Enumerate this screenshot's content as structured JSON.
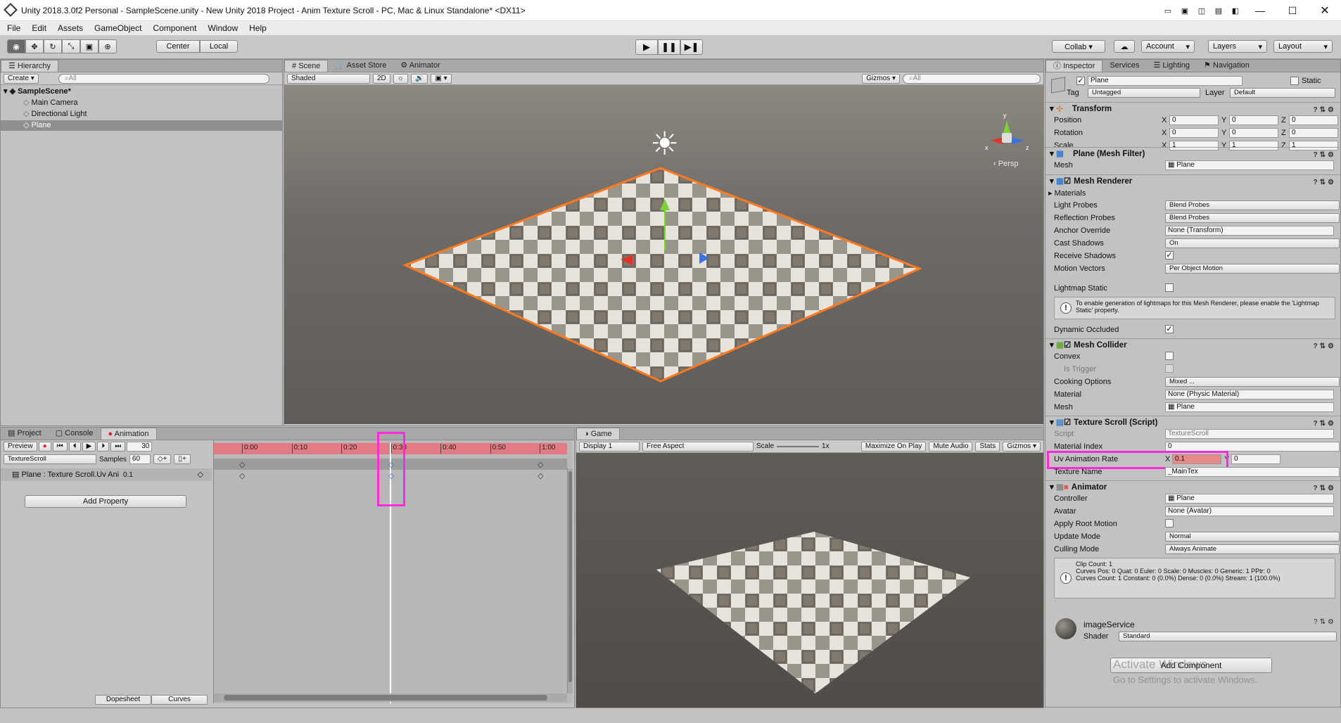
{
  "window": {
    "title": "Unity 2018.3.0f2 Personal - SampleScene.unity - New Unity 2018 Project - Anim Texture Scroll - PC, Mac & Linux Standalone* <DX11>"
  },
  "menu": [
    "File",
    "Edit",
    "Assets",
    "GameObject",
    "Component",
    "Window",
    "Help"
  ],
  "toolbar": {
    "center": "Center",
    "local": "Local",
    "collab": "Collab ▾",
    "account": "Account",
    "layers": "Layers",
    "layout": "Layout"
  },
  "hierarchy": {
    "tab": "Hierarchy",
    "create": "Create",
    "search": "All",
    "scene": "SampleScene*",
    "items": [
      "Main Camera",
      "Directional Light",
      "Plane"
    ]
  },
  "scene": {
    "tabs": [
      "Scene",
      "Asset Store",
      "Animator"
    ],
    "shading": "Shaded",
    "mode2d": "2D",
    "gizmos": "Gizmos",
    "search": "All",
    "persp": "Persp",
    "axis_x": "x",
    "axis_y": "y",
    "axis_z": "z"
  },
  "bottomtabs": {
    "project": "Project",
    "console": "Console",
    "animation": "Animation"
  },
  "animation": {
    "preview": "Preview",
    "frame": "30",
    "clip": "TextureScroll",
    "samples_label": "Samples",
    "samples": "60",
    "property": "Plane : Texture Scroll.Uv Ani",
    "prop_value": "0.1",
    "add_property": "Add Property",
    "dopesheet": "Dopesheet",
    "curves": "Curves",
    "ticks": [
      "0:00",
      "0:10",
      "0:20",
      "0:30",
      "0:40",
      "0:50",
      "1:00"
    ]
  },
  "game": {
    "tab": "Game",
    "display": "Display 1",
    "aspect": "Free Aspect",
    "scale_label": "Scale",
    "scale_val": "1x",
    "maximize": "Maximize On Play",
    "mute": "Mute Audio",
    "stats": "Stats",
    "gizmos": "Gizmos"
  },
  "inspector": {
    "tabs": [
      "Inspector",
      "Services",
      "Lighting",
      "Navigation"
    ],
    "name": "Plane",
    "static": "Static",
    "tag_label": "Tag",
    "tag": "Untagged",
    "layer_label": "Layer",
    "layer": "Default",
    "transform": {
      "title": "Transform",
      "rows": [
        {
          "label": "Position",
          "x": "0",
          "y": "0",
          "z": "0"
        },
        {
          "label": "Rotation",
          "x": "0",
          "y": "0",
          "z": "0"
        },
        {
          "label": "Scale",
          "x": "1",
          "y": "1",
          "z": "1"
        }
      ]
    },
    "meshfilter": {
      "title": "Plane (Mesh Filter)",
      "mesh_label": "Mesh",
      "mesh": "Plane"
    },
    "meshrenderer": {
      "title": "Mesh Renderer",
      "materials": "Materials",
      "light_probes_label": "Light Probes",
      "light_probes": "Blend Probes",
      "reflection_label": "Reflection Probes",
      "reflection": "Blend Probes",
      "anchor_label": "Anchor Override",
      "anchor": "None (Transform)",
      "cast_label": "Cast Shadows",
      "cast": "On",
      "receive_label": "Receive Shadows",
      "motion_label": "Motion Vectors",
      "motion": "Per Object Motion",
      "lightmap_label": "Lightmap Static",
      "help": "To enable generation of lightmaps for this Mesh Renderer, please enable the 'Lightmap Static' property.",
      "dynamic_label": "Dynamic Occluded"
    },
    "meshcollider": {
      "title": "Mesh Collider",
      "convex": "Convex",
      "trigger": "Is Trigger",
      "cooking_label": "Cooking Options",
      "cooking": "Mixed ...",
      "material_label": "Material",
      "material": "None (Physic Material)",
      "mesh_label": "Mesh",
      "mesh": "Plane"
    },
    "texturescroll": {
      "title": "Texture Scroll (Script)",
      "script_label": "Script",
      "script": "TextureScroll",
      "matindex_label": "Material Index",
      "matindex": "0",
      "uv_label": "Uv Animation Rate",
      "uv_x": "0.1",
      "uv_y": "0",
      "texname_label": "Texture Name",
      "texname": "_MainTex"
    },
    "animator": {
      "title": "Animator",
      "controller_label": "Controller",
      "controller": "Plane",
      "avatar_label": "Avatar",
      "avatar": "None (Avatar)",
      "rootmotion_label": "Apply Root Motion",
      "update_label": "Update Mode",
      "update": "Normal",
      "culling_label": "Culling Mode",
      "culling": "Always Animate",
      "info": "Clip Count: 1\nCurves Pos: 0 Quat: 0 Euler: 0 Scale: 0 Muscles: 0 Generic: 1 PPtr: 0\nCurves Count: 1 Constant: 0 (0.0%) Dense: 0 (0.0%) Stream: 1 (100.0%)"
    },
    "material": {
      "name": "imageService",
      "shader_label": "Shader",
      "shader": "Standard"
    },
    "add_component": "Add Component",
    "watermark1": "Activate Windows",
    "watermark2": "Go to Settings to activate Windows."
  }
}
